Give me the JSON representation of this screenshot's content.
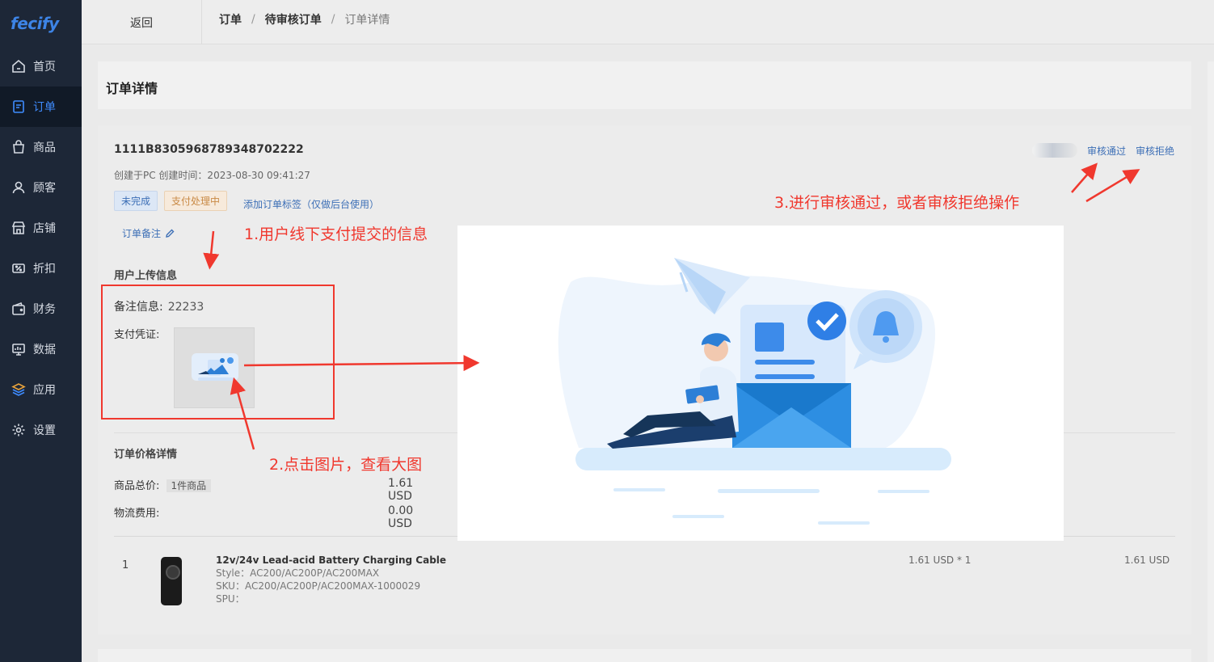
{
  "logo": {
    "text": "fecify"
  },
  "sidebar": {
    "items": [
      {
        "label": "首页",
        "icon": "home-icon",
        "active": false
      },
      {
        "label": "订单",
        "icon": "order-icon",
        "active": true
      },
      {
        "label": "商品",
        "icon": "bag-icon",
        "active": false
      },
      {
        "label": "顾客",
        "icon": "user-icon",
        "active": false
      },
      {
        "label": "店铺",
        "icon": "store-icon",
        "active": false
      },
      {
        "label": "折扣",
        "icon": "discount-icon",
        "active": false
      },
      {
        "label": "财务",
        "icon": "wallet-icon",
        "active": false
      },
      {
        "label": "数据",
        "icon": "chart-icon",
        "active": false
      },
      {
        "label": "应用",
        "icon": "apps-icon",
        "active": false
      },
      {
        "label": "设置",
        "icon": "gear-icon",
        "active": false
      }
    ]
  },
  "topbar": {
    "back_label": "返回",
    "breadcrumb": [
      "订单",
      "待审核订单",
      "订单详情"
    ],
    "separator": "/"
  },
  "page": {
    "title": "订单详情"
  },
  "order": {
    "id": "1111B8305968789348702222",
    "created": "创建于PC 创建时间：2023-08-30 09:41:27",
    "status_tags": [
      "未完成",
      "支付处理中"
    ],
    "add_tag_link": "添加订单标签（仅做后台使用）",
    "remark_link": "订单备注",
    "actions": {
      "approve": "审核通过",
      "reject": "审核拒绝"
    }
  },
  "upload_info": {
    "section_title": "用户上传信息",
    "note_label": "备注信息:",
    "note_value": "22233",
    "proof_label": "支付凭证:"
  },
  "price_detail": {
    "section_title": "订单价格详情",
    "goods_total_label": "商品总价:",
    "goods_count": "1件商品",
    "goods_total_value": "1.61 USD",
    "shipping_label": "物流费用:",
    "shipping_value": "0.00 USD"
  },
  "items": [
    {
      "index": "1",
      "name": "12v/24v Lead-acid Battery Charging Cable",
      "style": "Style：AC200/AC200P/AC200MAX",
      "sku": "SKU：AC200/AC200P/AC200MAX-1000029",
      "spu": "SPU：",
      "unit_price": "1.61 USD * 1",
      "total": "1.61 USD"
    }
  ],
  "annotations": {
    "step1": "1.用户线下支付提交的信息",
    "step2": "2.点击图片，查看大图",
    "step3": "3.进行审核通过，或者审核拒绝操作"
  },
  "colors": {
    "sidebar_bg": "#1d2737",
    "accent": "#3f8cff",
    "link": "#3d6fb6",
    "annotation": "#f0382e"
  }
}
